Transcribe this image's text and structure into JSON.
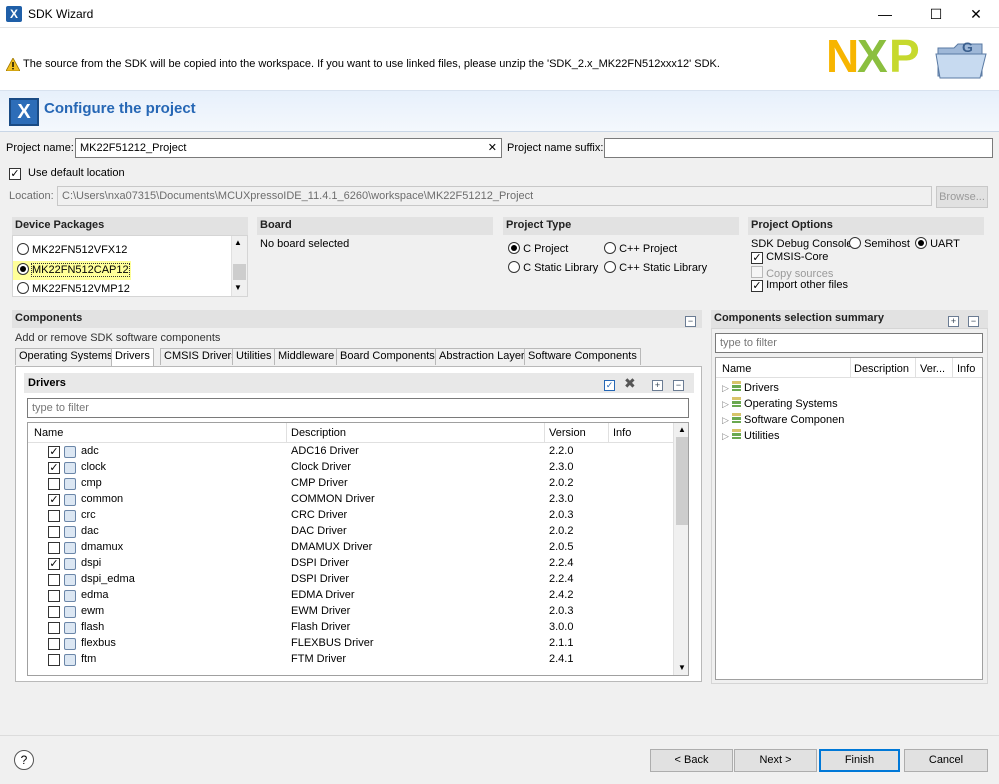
{
  "window": {
    "title": "SDK Wizard",
    "controls": {
      "minimize": "—",
      "maximize": "☐",
      "close": "✕"
    }
  },
  "header": {
    "warning": "The source from the SDK will be copied into the workspace. If you want to use linked files, please unzip the 'SDK_2.x_MK22FN512xxx12' SDK.",
    "logo_text": "NXP",
    "section_title": "Configure the project"
  },
  "form": {
    "project_name_label": "Project name:",
    "project_name_value": "MK22F51212_Project",
    "project_name_suffix_label": "Project name suffix:",
    "project_name_suffix_value": "",
    "use_default_location_label": "Use default location",
    "location_label": "Location:",
    "location_value": "C:\\Users\\nxa07315\\Documents\\MCUXpressoIDE_11.4.1_6260\\workspace\\MK22F51212_Project",
    "browse_label": "Browse..."
  },
  "device_packages": {
    "title": "Device Packages",
    "items": [
      {
        "label": "MK22FN512VFX12",
        "selected": false
      },
      {
        "label": "MK22FN512CAP12",
        "selected": true
      },
      {
        "label": "MK22FN512VMP12",
        "selected": false
      }
    ]
  },
  "board": {
    "title": "Board",
    "value": "No board selected"
  },
  "project_type": {
    "title": "Project Type",
    "options": [
      {
        "label": "C Project",
        "selected": true
      },
      {
        "label": "C++ Project",
        "selected": false
      },
      {
        "label": "C Static Library",
        "selected": false
      },
      {
        "label": "C++ Static Library",
        "selected": false
      }
    ]
  },
  "project_options": {
    "title": "Project Options",
    "sdk_debug_console_label": "SDK Debug Console",
    "semihost_label": "Semihost",
    "uart_label": "UART",
    "cmsis_core_label": "CMSIS-Core",
    "copy_sources_label": "Copy sources",
    "import_other_files_label": "Import other files"
  },
  "components": {
    "title": "Components",
    "subtitle": "Add or remove SDK software components",
    "tabs": [
      "Operating Systems",
      "Drivers",
      "CMSIS Drivers",
      "Utilities",
      "Middleware",
      "Board Components",
      "Abstraction Layer",
      "Software Components"
    ],
    "active_tab": "Drivers",
    "drivers_title": "Drivers",
    "filter_placeholder": "type to filter",
    "columns": {
      "name": "Name",
      "description": "Description",
      "version": "Version",
      "info": "Info"
    },
    "rows": [
      {
        "name": "adc",
        "description": "ADC16 Driver",
        "version": "2.2.0",
        "checked": true
      },
      {
        "name": "clock",
        "description": "Clock Driver",
        "version": "2.3.0",
        "checked": true
      },
      {
        "name": "cmp",
        "description": "CMP Driver",
        "version": "2.0.2",
        "checked": false
      },
      {
        "name": "common",
        "description": "COMMON Driver",
        "version": "2.3.0",
        "checked": true
      },
      {
        "name": "crc",
        "description": "CRC Driver",
        "version": "2.0.3",
        "checked": false
      },
      {
        "name": "dac",
        "description": "DAC Driver",
        "version": "2.0.2",
        "checked": false
      },
      {
        "name": "dmamux",
        "description": "DMAMUX Driver",
        "version": "2.0.5",
        "checked": false
      },
      {
        "name": "dspi",
        "description": "DSPI Driver",
        "version": "2.2.4",
        "checked": true
      },
      {
        "name": "dspi_edma",
        "description": "DSPI Driver",
        "version": "2.2.4",
        "checked": false
      },
      {
        "name": "edma",
        "description": "EDMA Driver",
        "version": "2.4.2",
        "checked": false
      },
      {
        "name": "ewm",
        "description": "EWM Driver",
        "version": "2.0.3",
        "checked": false
      },
      {
        "name": "flash",
        "description": "Flash Driver",
        "version": "3.0.0",
        "checked": false
      },
      {
        "name": "flexbus",
        "description": "FLEXBUS Driver",
        "version": "2.1.1",
        "checked": false
      },
      {
        "name": "ftm",
        "description": "FTM Driver",
        "version": "2.4.1",
        "checked": false
      }
    ]
  },
  "summary": {
    "title": "Components selection summary",
    "filter_placeholder": "type to filter",
    "columns": {
      "name": "Name",
      "description": "Description",
      "version": "Ver...",
      "info": "Info"
    },
    "items": [
      "Drivers",
      "Operating Systems",
      "Software Componen",
      "Utilities"
    ]
  },
  "footer": {
    "help": "?",
    "back": "< Back",
    "next": "Next >",
    "finish": "Finish",
    "cancel": "Cancel"
  },
  "colors": {
    "accent": "#2667b5",
    "highlight": "#ffff99",
    "nxp_n": "#f7b500",
    "nxp_x": "#8bbf3f",
    "nxp_p": "#c6d92e"
  }
}
